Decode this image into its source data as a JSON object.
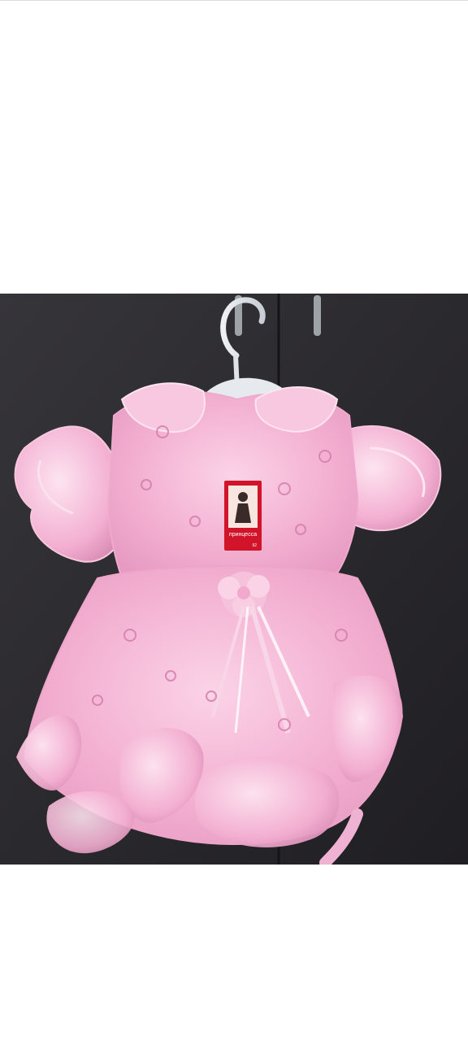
{
  "image": {
    "subject": "pink-frilly-girls-dress-icon",
    "background_color": "#ffffff",
    "photo_background_color": "#2c2b2f",
    "dress_color": "#f4b6d6",
    "tag": {
      "brand_text": "принцесса",
      "size_text": "92",
      "color": "#d2142a"
    }
  }
}
